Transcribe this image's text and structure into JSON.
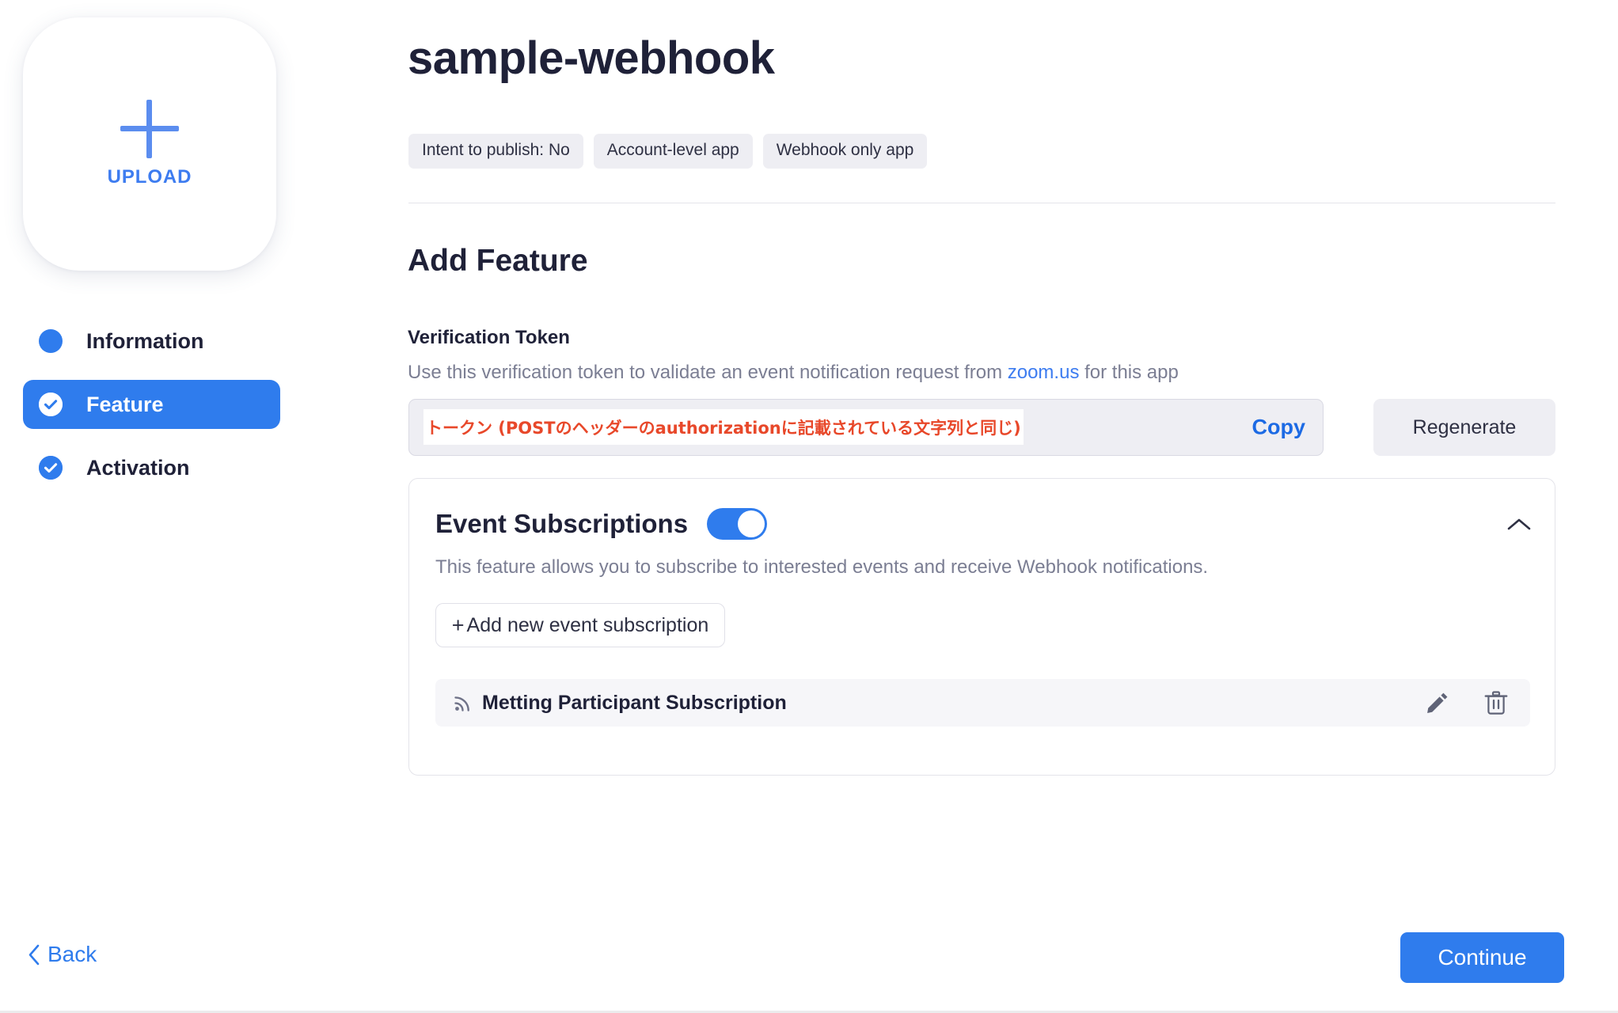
{
  "app": {
    "title": "sample-webhook",
    "badges": [
      "Intent to publish: No",
      "Account-level app",
      "Webhook only app"
    ]
  },
  "upload": {
    "label": "UPLOAD",
    "icon": "plus-icon"
  },
  "steps": [
    {
      "label": "Information",
      "state": "dot",
      "active": false
    },
    {
      "label": "Feature",
      "state": "check",
      "active": true
    },
    {
      "label": "Activation",
      "state": "check",
      "active": false
    }
  ],
  "section": {
    "title": "Add Feature"
  },
  "verification_token": {
    "label": "Verification Token",
    "description_before": "Use this verification token to validate an event notification request from ",
    "link_text": "zoom.us",
    "description_after": " for this app",
    "value": "トークン (POSTのヘッダーのauthorizationに記載されている文字列と同じ)",
    "copy_label": "Copy",
    "regenerate_label": "Regenerate"
  },
  "event_subscriptions": {
    "title": "Event Subscriptions",
    "toggle_on": true,
    "description": "This feature allows you to subscribe to interested events and receive Webhook notifications.",
    "add_button_label": "Add new event subscription",
    "add_button_plus": "+",
    "collapse_icon": "chevron-up-icon",
    "rows": [
      {
        "name": "Metting Participant Subscription",
        "icon": "broadcast-icon",
        "edit_icon": "pencil-icon",
        "delete_icon": "trash-icon"
      }
    ]
  },
  "footer": {
    "back_label": "Back",
    "continue_label": "Continue"
  },
  "colors": {
    "accent": "#2f7ced",
    "link": "#3d7cf0",
    "token_text": "#e8482a",
    "badge_bg": "#eeeef3",
    "muted_text": "#7b7e93",
    "heading": "#1f2138"
  }
}
